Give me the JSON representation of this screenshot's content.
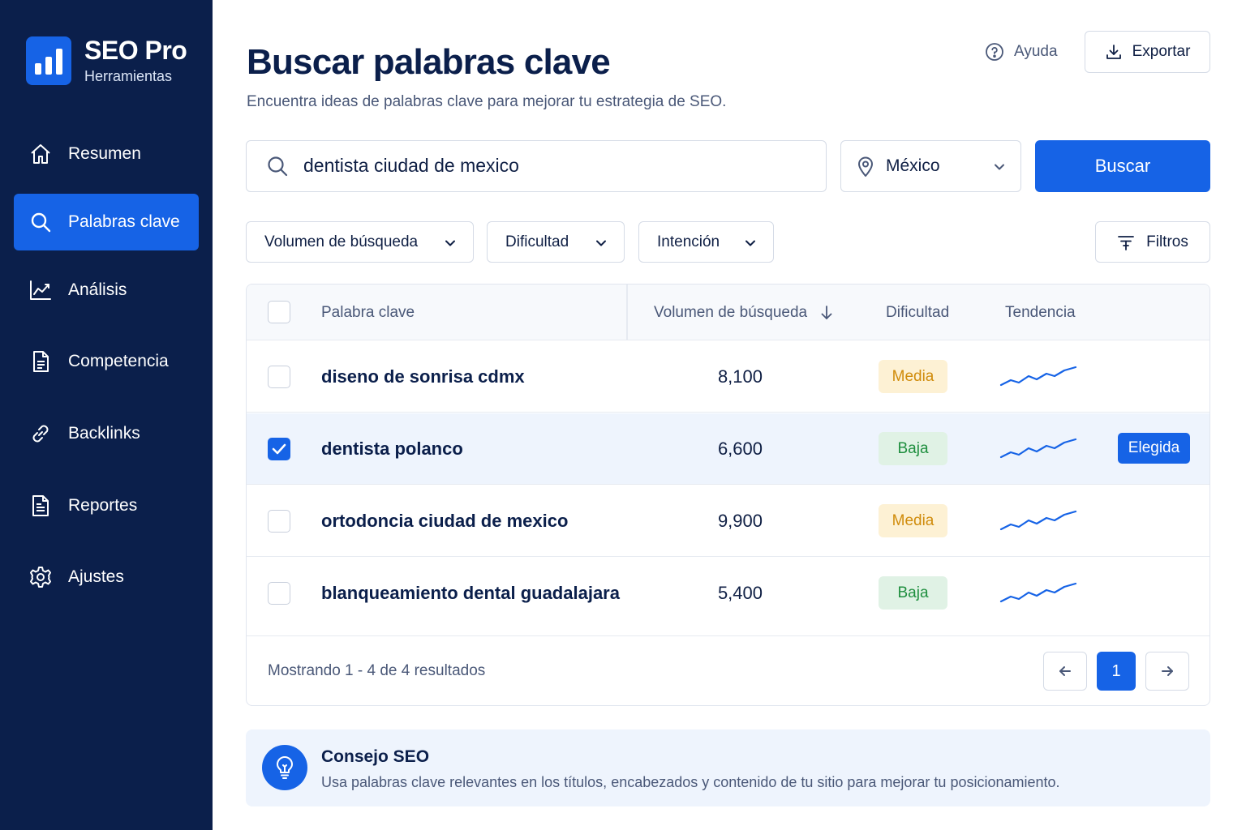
{
  "brand": {
    "name": "SEO Pro",
    "subtitle": "Herramientas"
  },
  "sidebar": {
    "items": [
      {
        "label": "Resumen",
        "icon": "home-icon",
        "active": false
      },
      {
        "label": "Palabras clave",
        "icon": "search-icon",
        "active": true
      },
      {
        "label": "Análisis",
        "icon": "chart-line-icon",
        "active": false
      },
      {
        "label": "Competencia",
        "icon": "document-icon",
        "active": false
      },
      {
        "label": "Backlinks",
        "icon": "link-icon",
        "active": false
      },
      {
        "label": "Reportes",
        "icon": "report-icon",
        "active": false
      },
      {
        "label": "Ajustes",
        "icon": "gear-icon",
        "active": false
      }
    ]
  },
  "header": {
    "title": "Buscar palabras clave",
    "subtitle": "Encuentra ideas de palabras clave para mejorar tu estrategia de SEO.",
    "help_label": "Ayuda",
    "export_label": "Exportar"
  },
  "search": {
    "value": "dentista ciudad de mexico",
    "location": "México",
    "button_label": "Buscar"
  },
  "filters": {
    "dropdowns": [
      "Volumen de búsqueda",
      "Dificultad",
      "Intención"
    ],
    "filters_label": "Filtros"
  },
  "table": {
    "columns": {
      "keyword": "Palabra clave",
      "volume": "Volumen de búsqueda",
      "difficulty": "Dificultad",
      "trend": "Tendencia"
    },
    "sort_column": "volume",
    "sort_direction": "descending",
    "rows": [
      {
        "keyword": "diseno de sonrisa cdmx",
        "volume": "8,100",
        "difficulty": "Media",
        "checked": false
      },
      {
        "keyword": "dentista polanco",
        "volume": "6,600",
        "difficulty": "Baja",
        "checked": true,
        "tag": "Elegida"
      },
      {
        "keyword": "ortodoncia ciudad de mexico",
        "volume": "9,900",
        "difficulty": "Media",
        "checked": false
      },
      {
        "keyword": "blanqueamiento dental guadalajara",
        "volume": "5,400",
        "difficulty": "Baja",
        "checked": false
      }
    ],
    "footer": {
      "showing": "Mostrando 1 - 4 de 4 resultados",
      "current_page": "1"
    }
  },
  "tip": {
    "title": "Consejo SEO",
    "text": "Usa palabras clave relevantes en los títulos, encabezados y contenido de tu sitio para mejorar tu posicionamiento.",
    "icon": "lightbulb-icon"
  },
  "colors": {
    "sidebar_bg": "#0b1f4b",
    "accent": "#1663e6",
    "badge_media_bg": "#fdf1d4",
    "badge_media_text": "#d08c0c",
    "badge_baja_bg": "#e0f2e5",
    "badge_baja_text": "#1f8f3f"
  }
}
